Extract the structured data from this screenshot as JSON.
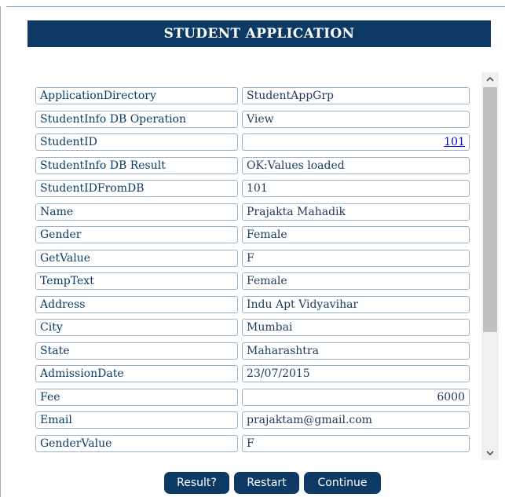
{
  "header": {
    "title": "STUDENT APPLICATION"
  },
  "fields": [
    {
      "label": "ApplicationDirectory",
      "value": "StudentAppGrp"
    },
    {
      "label": "StudentInfo DB Operation",
      "value": "View"
    },
    {
      "label": "StudentID",
      "value": "101",
      "link": true,
      "align": "right"
    },
    {
      "label": "StudentInfo DB Result",
      "value": "OK:Values loaded"
    },
    {
      "label": "StudentIDFromDB",
      "value": "101"
    },
    {
      "label": "Name",
      "value": "Prajakta Mahadik"
    },
    {
      "label": "Gender",
      "value": "Female"
    },
    {
      "label": "GetValue",
      "value": "F"
    },
    {
      "label": "TempText",
      "value": "Female"
    },
    {
      "label": "Address",
      "value": "Indu Apt Vidyavihar"
    },
    {
      "label": "City",
      "value": "Mumbai"
    },
    {
      "label": "State",
      "value": "Maharashtra"
    },
    {
      "label": "AdmissionDate",
      "value": "23/07/2015"
    },
    {
      "label": "Fee",
      "value": "6000",
      "align": "right"
    },
    {
      "label": "Email",
      "value": "prajaktam@gmail.com"
    },
    {
      "label": "GenderValue",
      "value": "F"
    }
  ],
  "buttons": {
    "result": "Result?",
    "restart": "Restart",
    "continue": "Continue"
  },
  "scrollbar": {
    "up_icon": "chevron-up-icon",
    "down_icon": "chevron-down-icon"
  },
  "colors": {
    "primary": "#0d3a64",
    "border": "#97b3cc",
    "link": "#0000ee"
  }
}
